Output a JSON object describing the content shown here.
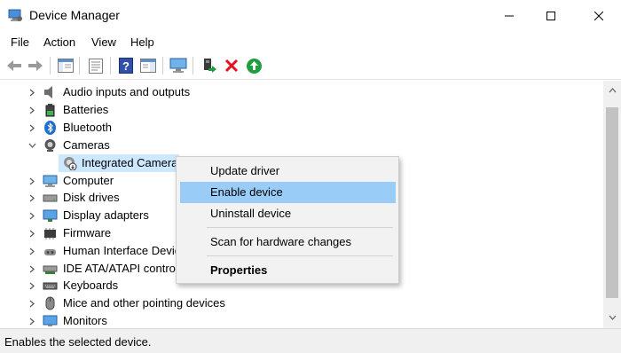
{
  "window": {
    "title": "Device Manager",
    "app_icon": "device-manager-icon",
    "controls": [
      "minimize-icon",
      "maximize-icon",
      "close-icon"
    ]
  },
  "menu": {
    "items": [
      {
        "label": "File"
      },
      {
        "label": "Action"
      },
      {
        "label": "View"
      },
      {
        "label": "Help"
      }
    ]
  },
  "toolbar": {
    "buttons": [
      "back-arrow-icon",
      "forward-arrow-icon",
      "show-hide-console-tree-icon",
      "properties-icon",
      "help-icon",
      "action-pane-icon",
      "scan-hardware-icon",
      "update-driver-icon",
      "uninstall-icon",
      "enable-device-icon"
    ],
    "colors": {
      "uninstall": "#e81123",
      "enable": "#1e9e3e",
      "help": "#2f4fa8"
    }
  },
  "tree": {
    "items": [
      {
        "label": "Audio inputs and outputs",
        "icon": "speaker-icon",
        "expanded": false
      },
      {
        "label": "Batteries",
        "icon": "battery-icon",
        "expanded": false
      },
      {
        "label": "Bluetooth",
        "icon": "bluetooth-icon",
        "expanded": false
      },
      {
        "label": "Cameras",
        "icon": "camera-icon",
        "expanded": true
      },
      {
        "label": "Integrated Camera",
        "icon": "disabled-camera-icon",
        "child": true,
        "selected": true
      },
      {
        "label": "Computer",
        "icon": "computer-icon",
        "expanded": false
      },
      {
        "label": "Disk drives",
        "icon": "disk-drive-icon",
        "expanded": false
      },
      {
        "label": "Display adapters",
        "icon": "display-adapter-icon",
        "expanded": false
      },
      {
        "label": "Firmware",
        "icon": "firmware-icon",
        "expanded": false
      },
      {
        "label": "Human Interface Devic",
        "icon": "hid-icon",
        "expanded": false
      },
      {
        "label": "IDE ATA/ATAPI controlle",
        "icon": "ide-controller-icon",
        "expanded": false
      },
      {
        "label": "Keyboards",
        "icon": "keyboard-icon",
        "expanded": false
      },
      {
        "label": "Mice and other pointing devices",
        "icon": "mouse-icon",
        "expanded": false
      },
      {
        "label": "Monitors",
        "icon": "monitor-icon",
        "expanded": false
      }
    ],
    "selection_color": "#cce8ff"
  },
  "context_menu": {
    "items": [
      {
        "label": "Update driver"
      },
      {
        "label": "Enable device",
        "highlighted": true
      },
      {
        "label": "Uninstall device"
      },
      {
        "label": "Scan for hardware changes"
      },
      {
        "label": "Properties",
        "bold": true
      }
    ],
    "highlight_color": "#99ccf6"
  },
  "status": {
    "text": "Enables the selected device."
  }
}
